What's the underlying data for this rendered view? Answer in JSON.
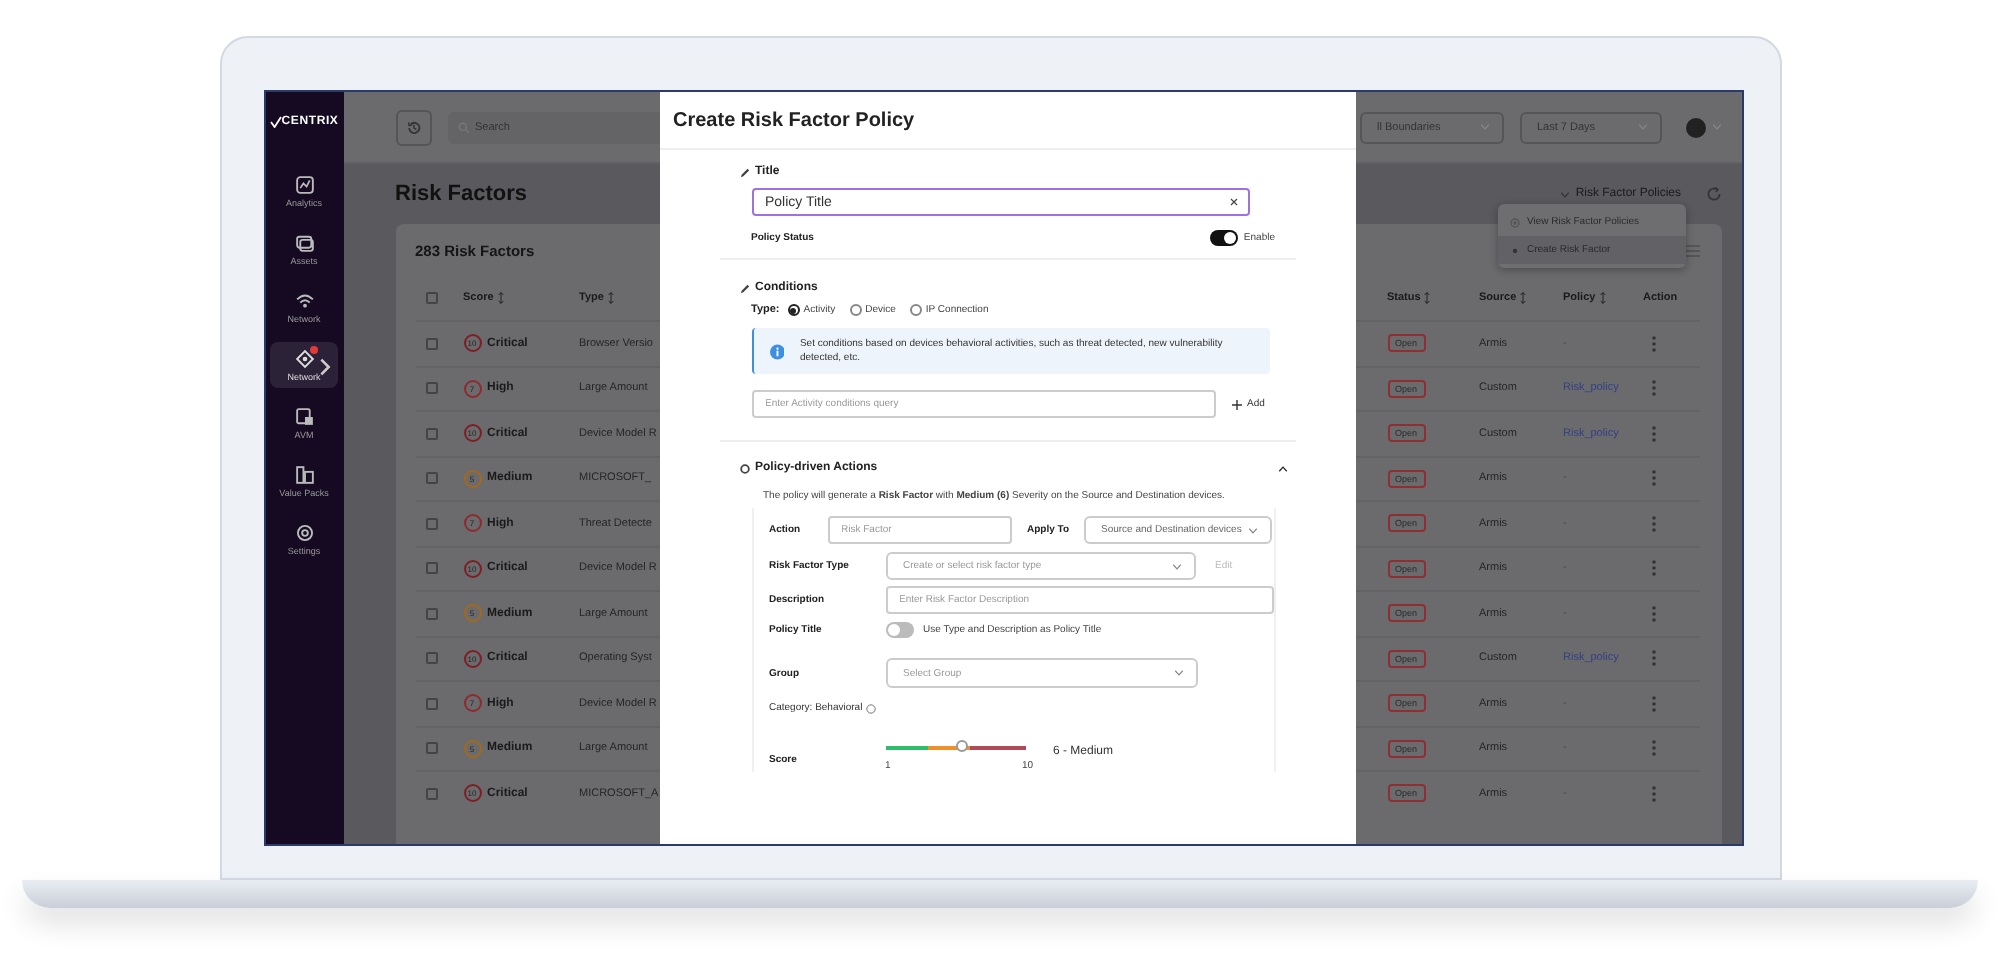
{
  "sidebar": {
    "logo": "CENTRIX",
    "items": [
      {
        "label": "Analytics",
        "selected": false
      },
      {
        "label": "Assets",
        "selected": false
      },
      {
        "label": "Network",
        "selected": false
      },
      {
        "label": "Network",
        "selected": true
      },
      {
        "label": "AVM",
        "selected": false
      },
      {
        "label": "Value Packs",
        "selected": false
      },
      {
        "label": "Settings",
        "selected": false
      }
    ]
  },
  "topbar": {
    "search": {
      "placeholder": "Search"
    },
    "boundaries": "ll Boundaries",
    "period": "Last 7 Days"
  },
  "page": {
    "title": "Risk Factors",
    "policies_button": "Risk Factor Policies",
    "menu": [
      {
        "label": "View Risk Factor Policies",
        "selected": false
      },
      {
        "label": "Create Risk Factor",
        "selected": true
      }
    ]
  },
  "table": {
    "count": "283 Risk Factors",
    "all_checked": false,
    "columns": [
      {
        "label": "Score",
        "sortable": true
      },
      {
        "label": "Type",
        "sortable": true
      },
      {
        "label": "Status",
        "sortable": true
      },
      {
        "label": "Source",
        "sortable": true
      },
      {
        "label": "Policy",
        "sortable": true
      },
      {
        "label": "Action",
        "sortable": false
      }
    ],
    "rows": [
      {
        "checked": false,
        "score": "10",
        "severity": "Critical",
        "color": "#7d1e25",
        "type": "Browser Versio",
        "status": "Open",
        "source": "Armis",
        "policy": "-",
        "policy_link": false
      },
      {
        "checked": false,
        "score": "7",
        "severity": "High",
        "color": "#8e2a2e",
        "type": "Large Amount",
        "status": "Open",
        "source": "Custom",
        "policy": "Risk_policy",
        "policy_link": true
      },
      {
        "checked": false,
        "score": "10",
        "severity": "Critical",
        "color": "#7d1e25",
        "type": "Device Model R",
        "status": "Open",
        "source": "Custom",
        "policy": "Risk_policy",
        "policy_link": true
      },
      {
        "checked": false,
        "score": "5",
        "severity": "Medium",
        "color": "#a3691c",
        "type": "MICROSOFT_",
        "status": "Open",
        "source": "Armis",
        "policy": "-",
        "policy_link": false
      },
      {
        "checked": false,
        "score": "7",
        "severity": "High",
        "color": "#8e2a2e",
        "type": "Threat Detecte",
        "status": "Open",
        "source": "Armis",
        "policy": "-",
        "policy_link": false
      },
      {
        "checked": false,
        "score": "10",
        "severity": "Critical",
        "color": "#7d1e25",
        "type": "Device Model R",
        "status": "Open",
        "source": "Armis",
        "policy": "-",
        "policy_link": false
      },
      {
        "checked": false,
        "score": "5",
        "severity": "Medium",
        "color": "#a3691c",
        "type": "Large Amount",
        "status": "Open",
        "source": "Armis",
        "policy": "-",
        "policy_link": false
      },
      {
        "checked": false,
        "score": "10",
        "severity": "Critical",
        "color": "#7d1e25",
        "type": "Operating Syst",
        "status": "Open",
        "source": "Custom",
        "policy": "Risk_policy",
        "policy_link": true
      },
      {
        "checked": false,
        "score": "7",
        "severity": "High",
        "color": "#8e2a2e",
        "type": "Device Model R",
        "status": "Open",
        "source": "Armis",
        "policy": "-",
        "policy_link": false
      },
      {
        "checked": false,
        "score": "5",
        "severity": "Medium",
        "color": "#a3691c",
        "type": "Large Amount",
        "status": "Open",
        "source": "Armis",
        "policy": "-",
        "policy_link": false
      },
      {
        "checked": false,
        "score": "10",
        "severity": "Critical",
        "color": "#7d1e25",
        "type": "MICROSOFT_A",
        "status": "Open",
        "source": "Armis",
        "policy": "-",
        "policy_link": false
      }
    ]
  },
  "modal": {
    "title": "Create Risk Factor Policy",
    "title_section": {
      "heading": "Title",
      "value": "Policy Title",
      "status_label": "Policy Status",
      "status_on": true,
      "status_text": "Enable"
    },
    "conditions": {
      "heading": "Conditions",
      "type_label": "Type:",
      "types": [
        {
          "label": "Activity",
          "selected": true
        },
        {
          "label": "Device",
          "selected": false
        },
        {
          "label": "IP Connection",
          "selected": false
        }
      ],
      "info": "Set conditions based on devices behavioral activities, such as threat detected, new vulnerability detected, etc.",
      "query_placeholder": "Enter Activity conditions query",
      "add": "Add"
    },
    "actions": {
      "heading": "Policy-driven Actions",
      "expanded": true,
      "summary": "The policy will generate a **Risk Factor** with **Medium (6)** Severity on the Source and Destination devices.",
      "action_label": "Action",
      "action_placeholder": "Risk Factor",
      "apply_label": "Apply To",
      "apply_value": "Source and Destination devices",
      "type_label": "Risk Factor Type",
      "type_placeholder": "Create or select risk factor type",
      "edit": "Edit",
      "edit_disabled": true,
      "description_label": "Description",
      "description_placeholder": "Enter Risk Factor Description",
      "policy_title_label": "Policy Title",
      "use_title_on": false,
      "use_title_text": "Use Type and Description as Policy Title",
      "group_label": "Group",
      "group_placeholder": "Select Group",
      "category": "Category: Behavioral",
      "score_label": "Score",
      "score": {
        "level": 0.556,
        "reading": "6 - Medium",
        "min": "1",
        "max": "10"
      }
    }
  }
}
